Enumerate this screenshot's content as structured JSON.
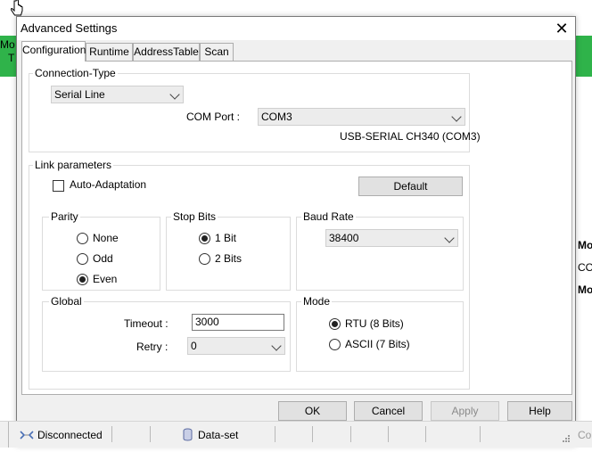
{
  "background": {
    "left_text_1": "Mo",
    "left_text_2": "T",
    "right_text_1": "Mo",
    "right_text_2": "CO",
    "right_text_3": "Mo",
    "status_right_text": "Co",
    "accent_color": "#2fb34a"
  },
  "dialog": {
    "title": "Advanced Settings",
    "close_glyph": "✕"
  },
  "tabs": [
    {
      "label": "Configuration"
    },
    {
      "label": "Runtime"
    },
    {
      "label": "AddressTable"
    },
    {
      "label": "Scan"
    }
  ],
  "connection": {
    "group_label": "Connection-Type",
    "type_value": "Serial Line",
    "com_port_label": "COM Port :",
    "com_port_value": "COM3",
    "com_port_desc": "USB-SERIAL CH340 (COM3)"
  },
  "link": {
    "group_label": "Link parameters",
    "auto_adaptation_label": "Auto-Adaptation",
    "default_button": "Default",
    "parity": {
      "label": "Parity",
      "options": [
        "None",
        "Odd",
        "Even"
      ],
      "selected": "Even"
    },
    "stop_bits": {
      "label": "Stop Bits",
      "options": [
        "1 Bit",
        "2 Bits"
      ],
      "selected": "1 Bit"
    },
    "baud_rate": {
      "label": "Baud Rate",
      "value": "38400"
    },
    "global": {
      "label": "Global",
      "timeout_label": "Timeout :",
      "timeout_value": "3000",
      "retry_label": "Retry :",
      "retry_value": "0"
    },
    "mode": {
      "label": "Mode",
      "options": [
        "RTU (8 Bits)",
        "ASCII (7 Bits)"
      ],
      "selected": "RTU (8 Bits)"
    }
  },
  "buttons": {
    "ok": "OK",
    "cancel": "Cancel",
    "apply": "Apply",
    "help": "Help"
  },
  "statusbar": {
    "connection_status": "Disconnected",
    "dataset": "Data-set"
  }
}
